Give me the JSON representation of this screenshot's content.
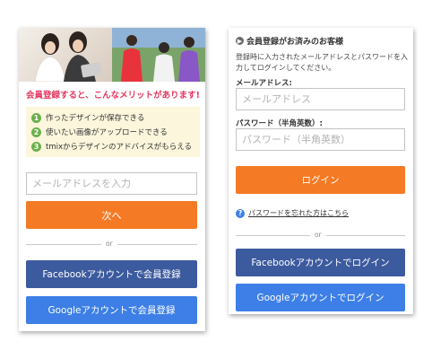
{
  "signup": {
    "promo_text": "会員登録すると、こんなメリットがあります!",
    "benefits": [
      {
        "num": "1",
        "text": "作ったデザインが保存できる"
      },
      {
        "num": "2",
        "text": "使いたい画像がアップロードできる"
      },
      {
        "num": "3",
        "text": "tmixからデザインのアドバイスがもらえる"
      }
    ],
    "email_placeholder": "メールアドレスを入力",
    "next_button": "次へ",
    "or": "or",
    "facebook_button": "Facebookアカウントで会員登録",
    "google_button": "Googleアカウントで会員登録"
  },
  "login": {
    "title": "会員登録がお済みのお客様",
    "description": "登録時に入力されたメールアドレスとパスワードを入力してログインしてください。",
    "email_label": "メールアドレス:",
    "email_placeholder": "メールアドレス",
    "password_label": "パスワード（半角英数）:",
    "password_placeholder": "パスワード（半角英数）",
    "login_button": "ログイン",
    "forgot_password": "パスワードを忘れた方はこちら",
    "help_mark": "?",
    "arrow_mark": "▶",
    "or": "or",
    "facebook_button": "Facebookアカウントでログイン",
    "google_button": "Googleアカウントでログイン"
  },
  "colors": {
    "accent_orange": "#f57a25",
    "facebook_blue": "#3c5a9e",
    "google_blue": "#3d7fe6",
    "promo_pink": "#e5365f",
    "benefit_green": "#6ab04c"
  }
}
